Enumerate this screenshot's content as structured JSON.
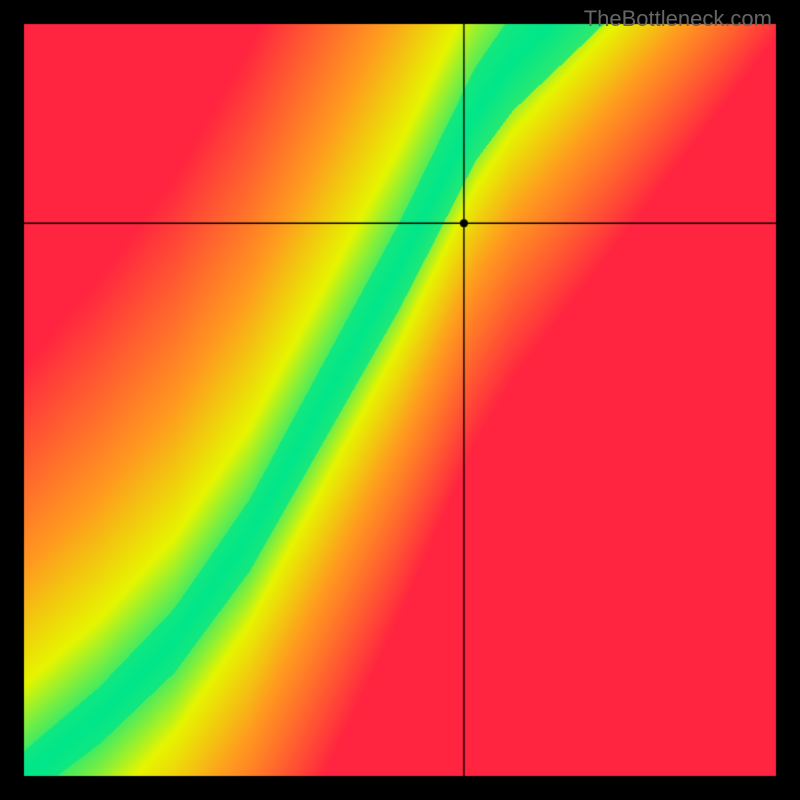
{
  "watermark": "TheBottleneck.com",
  "chart_data": {
    "type": "heatmap",
    "title": "",
    "xlabel": "",
    "ylabel": "",
    "xlim": [
      0,
      1
    ],
    "ylim": [
      0,
      1
    ],
    "crosshair": {
      "x": 0.585,
      "y": 0.735
    },
    "marker": {
      "x": 0.585,
      "y": 0.735,
      "radius": 4
    },
    "border_color": "#000000",
    "border_width": 24,
    "description": "Heatmap showing compatibility/bottleneck gradient. A diagonal green band curves from lower-left to upper-right indicating optimal pairing. Red regions in upper-left and lower-right indicate bottlenecks. Colors transition red→orange→yellow→green→yellow→orange across the diagonal band.",
    "colors": {
      "optimal": "#00e68a",
      "near": "#e6f500",
      "warn": "#ff9a1f",
      "bad": "#ff2440"
    },
    "optimal_curve_points": [
      {
        "x": 0.0,
        "y": 0.0
      },
      {
        "x": 0.1,
        "y": 0.08
      },
      {
        "x": 0.2,
        "y": 0.18
      },
      {
        "x": 0.3,
        "y": 0.32
      },
      {
        "x": 0.4,
        "y": 0.5
      },
      {
        "x": 0.5,
        "y": 0.68
      },
      {
        "x": 0.55,
        "y": 0.78
      },
      {
        "x": 0.6,
        "y": 0.88
      },
      {
        "x": 0.65,
        "y": 0.95
      },
      {
        "x": 0.7,
        "y": 1.0
      }
    ],
    "band_half_width": 0.055
  }
}
